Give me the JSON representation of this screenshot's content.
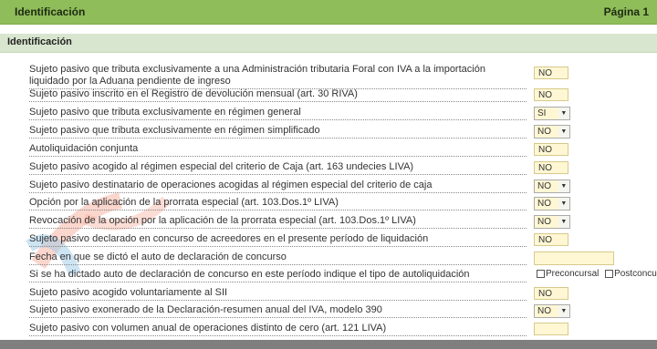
{
  "header": {
    "title": "Identificación",
    "page": "Página 1"
  },
  "section": {
    "title": "Identificación"
  },
  "rows": [
    {
      "label": "Sujeto pasivo que tributa exclusivamente a una Administración tributaria Foral con IVA a la importación liquidado por la Aduana pendiente de ingreso",
      "value": "NO"
    },
    {
      "label": "Sujeto pasivo inscrito en el Registro de devolución mensual (art. 30 RIVA)",
      "value": "NO"
    },
    {
      "label": "Sujeto pasivo que tributa exclusivamente en régimen general",
      "value": "SI"
    },
    {
      "label": "Sujeto pasivo que tributa exclusivamente en régimen simplificado",
      "value": "NO"
    },
    {
      "label": "Autoliquidación conjunta",
      "value": "NO"
    },
    {
      "label": "Sujeto pasivo acogido al régimen especial del criterio de Caja (art. 163 undecies LIVA)",
      "value": "NO"
    },
    {
      "label": "Sujeto pasivo destinatario de operaciones acogidas al régimen especial del criterio de caja",
      "value": "NO"
    },
    {
      "label": "Opción por la aplicación de la prorrata especial (art. 103.Dos.1º LIVA)",
      "value": "NO"
    },
    {
      "label": "Revocación de la opción por la aplicación de la prorrata especial (art. 103.Dos.1º LIVA)",
      "value": "NO"
    },
    {
      "label": "Sujeto pasivo declarado en concurso de acreedores en el presente período de liquidación",
      "value": "NO"
    },
    {
      "label": "Fecha en que se dictó el auto de declaración de concurso",
      "value": ""
    },
    {
      "label": "Si se ha dictado auto de declaración de concurso en este período indique el tipo de autoliquidación",
      "check1": "Preconcursal",
      "check2": "Postconcurso"
    },
    {
      "label": "Sujeto pasivo acogido voluntariamente al SII",
      "value": "NO"
    },
    {
      "label": "Sujeto pasivo exonerado de la Declaración-resumen anual del IVA, modelo 390",
      "value": "NO"
    },
    {
      "label": "Sujeto pasivo con volumen anual de operaciones distinto de cero (art. 121 LIVA)",
      "value": ""
    }
  ]
}
